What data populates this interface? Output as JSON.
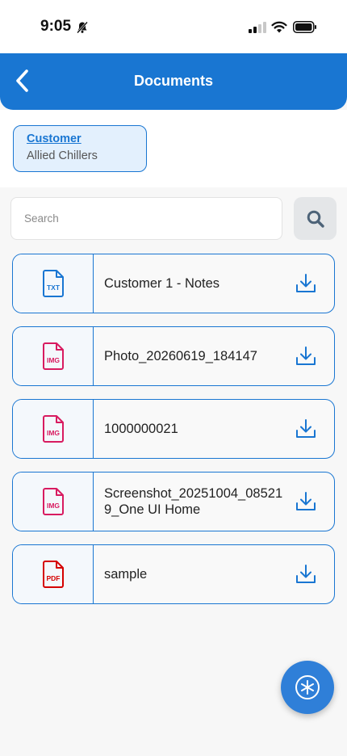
{
  "status_bar": {
    "time": "9:05",
    "icons": [
      "bell-slash-icon",
      "signal-icon",
      "wifi-icon",
      "battery-icon"
    ]
  },
  "header": {
    "title": "Documents",
    "back_icon": "chevron-left-icon"
  },
  "customer": {
    "label": "Customer",
    "value": "Allied Chillers"
  },
  "search": {
    "placeholder": "Search",
    "value": "",
    "button_icon": "search-icon"
  },
  "documents": [
    {
      "name": "Customer 1 - Notes",
      "type": "TXT",
      "color": "#1976d2"
    },
    {
      "name": "Photo_20260619_184147",
      "type": "IMG",
      "color": "#d81b60"
    },
    {
      "name": "1000000021",
      "type": "IMG",
      "color": "#d81b60"
    },
    {
      "name": "Screenshot_20251004_085219_One UI Home",
      "type": "IMG",
      "color": "#d81b60"
    },
    {
      "name": "sample",
      "type": "PDF",
      "color": "#d50000"
    }
  ],
  "colors": {
    "primary": "#1976d2",
    "img_badge": "#d81b60",
    "pdf_badge": "#d50000",
    "fab": "#2f7fd8"
  },
  "fab": {
    "icon": "asterisk-icon"
  }
}
